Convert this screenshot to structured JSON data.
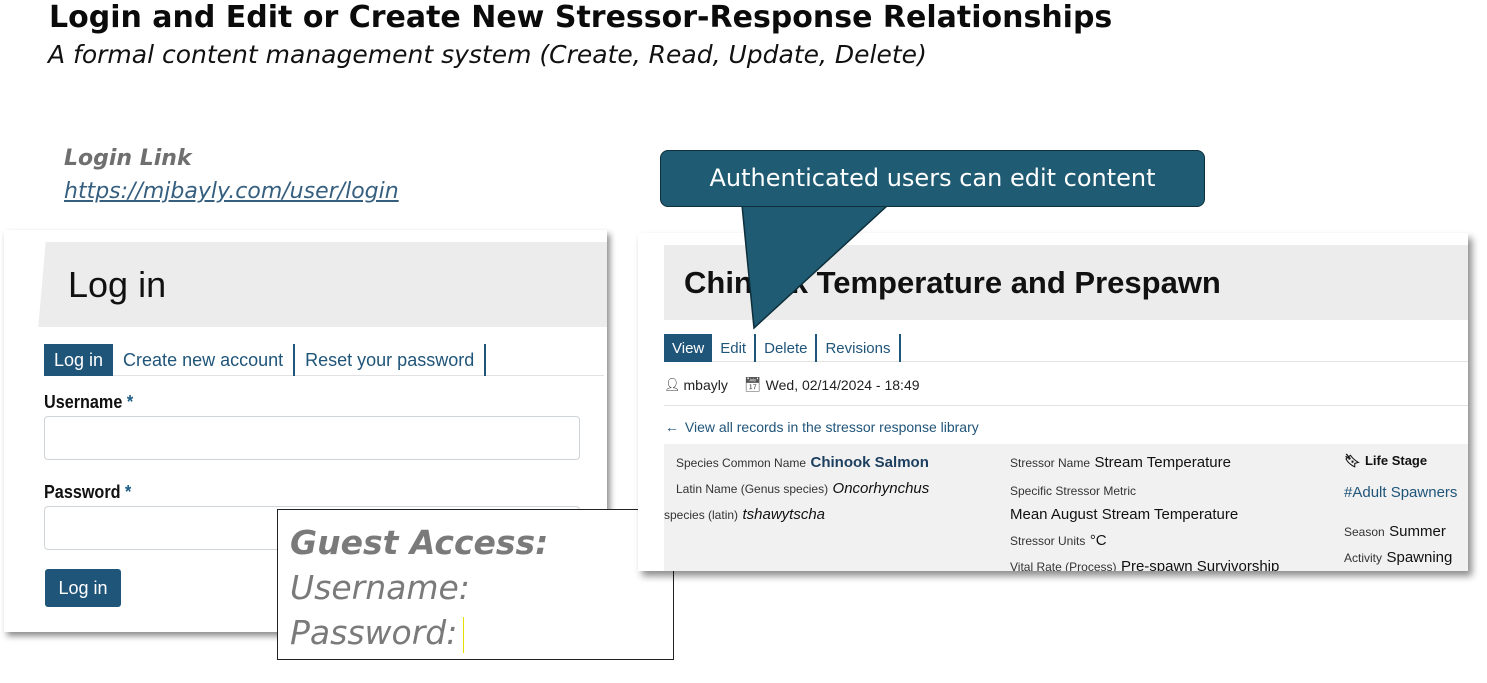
{
  "slide": {
    "title": "Login and Edit or Create New Stressor-Response Relationships",
    "subtitle": "A formal content management system (Create, Read, Update, Delete)",
    "login_link_label": "Login Link",
    "login_link_url": "https://mjbayly.com/user/login"
  },
  "login_page": {
    "heading": "Log in",
    "tabs": [
      {
        "label": "Log in",
        "active": true
      },
      {
        "label": "Create new account",
        "active": false
      },
      {
        "label": "Reset your password",
        "active": false
      }
    ],
    "username_label": "Username",
    "password_label": "Password",
    "required_marker": "*",
    "username_value": "",
    "password_value": "",
    "submit_label": "Log in"
  },
  "guest_access": {
    "title": "Guest Access:",
    "username_label": "Username:",
    "password_label": "Password:"
  },
  "callout": {
    "text": "Authenticated users can edit content",
    "fill_color": "#1f5b73"
  },
  "record_page": {
    "title": "Chinook Temperature and Prespawn",
    "tabs": [
      {
        "label": "View",
        "active": true
      },
      {
        "label": "Edit",
        "active": false
      },
      {
        "label": "Delete",
        "active": false
      },
      {
        "label": "Revisions",
        "active": false
      }
    ],
    "author": "mbayly",
    "date": "Wed, 02/14/2024 - 18:49",
    "back_link": "View all records in the stressor response library",
    "species_common_name_label": "Species Common Name",
    "species_common_name": "Chinook Salmon",
    "latin_name_label": "Latin Name (Genus species)",
    "latin_name": "Oncorhynchus",
    "species_latin_label": "species (latin)",
    "species_latin": "tshawytscha",
    "stressor_name_label": "Stressor Name",
    "stressor_name": "Stream Temperature",
    "specific_metric_label": "Specific Stressor Metric",
    "specific_metric": "Mean August Stream Temperature",
    "stressor_units_label": "Stressor Units",
    "stressor_units": "°C",
    "vital_rate_label": "Vital Rate (Process)",
    "vital_rate": "Pre-spawn Survivorship",
    "life_stage_label": "Life Stage",
    "life_stage_tag": "#Adult Spawners",
    "season_label": "Season",
    "season": "Summer",
    "activity_label": "Activity",
    "activity": "Spawning"
  },
  "colors": {
    "brand_blue": "#20557a",
    "panel_gray": "#ececec"
  }
}
